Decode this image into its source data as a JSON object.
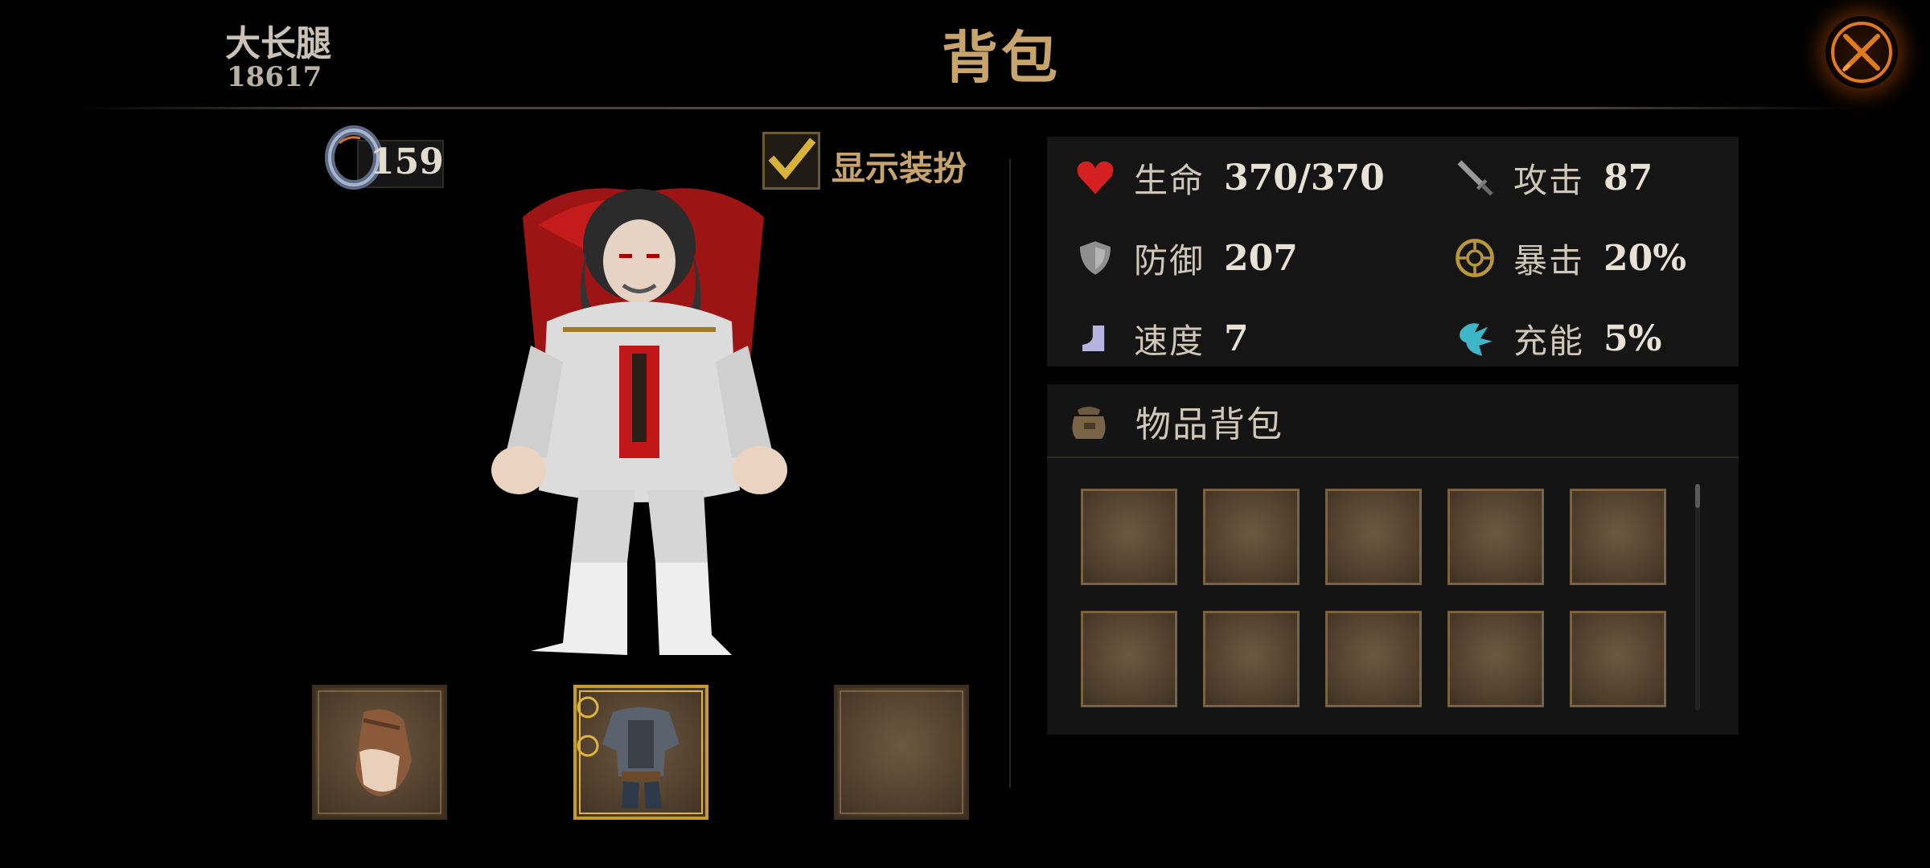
{
  "header": {
    "player_name": "大长腿",
    "player_id": "18617",
    "title": "背包"
  },
  "currency": {
    "icon": "ring-icon",
    "value": "159"
  },
  "costume_toggle": {
    "label": "显示装扮",
    "checked": true
  },
  "equipment_slots": [
    {
      "name": "gloves",
      "icon": "gauntlet-icon"
    },
    {
      "name": "armor",
      "icon": "armor-icon",
      "highlighted": true
    },
    {
      "name": "empty",
      "icon": ""
    }
  ],
  "stats": [
    {
      "icon": "heart-icon",
      "label": "生命",
      "value": "370/370",
      "color": "#d42020"
    },
    {
      "icon": "sword-icon",
      "label": "攻击",
      "value": "87",
      "color": "#8a8a8a"
    },
    {
      "icon": "shield-icon",
      "label": "防御",
      "value": "207",
      "color": "#9a9a9a"
    },
    {
      "icon": "crit-icon",
      "label": "暴击",
      "value": "20%",
      "color": "#b8963a"
    },
    {
      "icon": "boot-icon",
      "label": "速度",
      "value": "7",
      "color": "#b7b3e0"
    },
    {
      "icon": "energy-icon",
      "label": "充能",
      "value": "5%",
      "color": "#3fb6c8"
    }
  ],
  "inventory": {
    "icon": "bag-icon",
    "title": "物品背包",
    "slots": 10
  },
  "colors": {
    "title_gold": "#c7a46c",
    "close_glow": "#d25a0a",
    "panel_bg": "#151515"
  }
}
